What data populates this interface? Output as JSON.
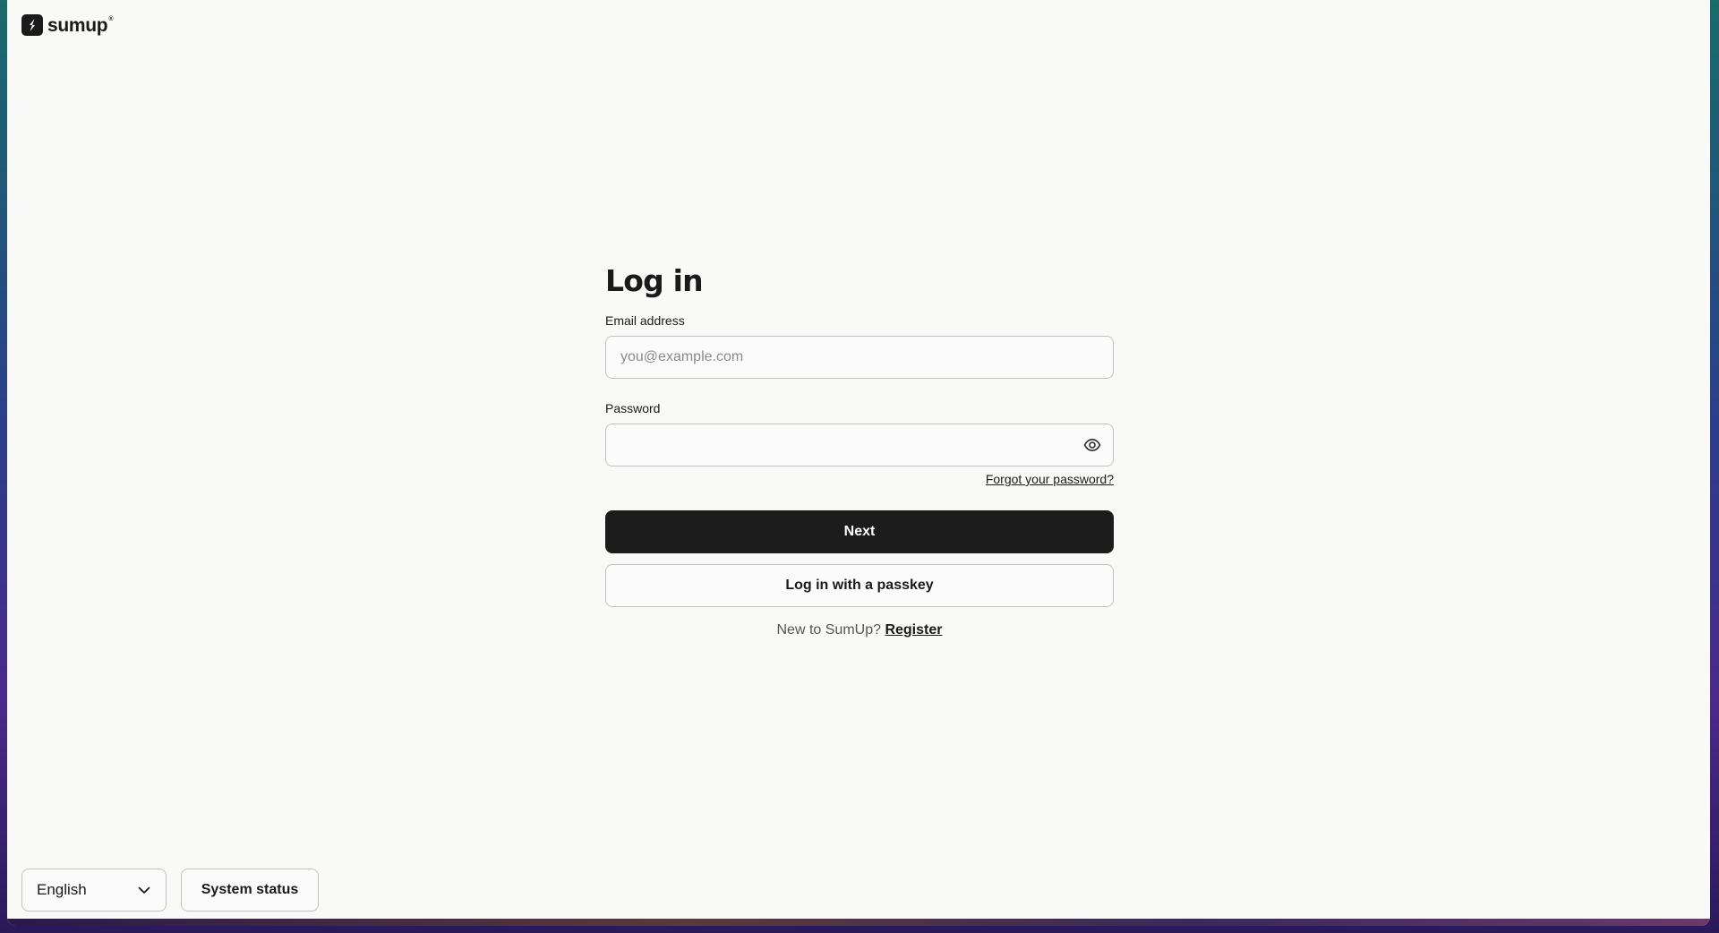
{
  "brand": {
    "name": "sumup",
    "registered_mark": "®"
  },
  "login": {
    "title": "Log in",
    "email": {
      "label": "Email address",
      "placeholder": "you@example.com",
      "value": ""
    },
    "password": {
      "label": "Password",
      "value": "",
      "toggle_icon": "eye-icon"
    },
    "forgot_password_label": "Forgot your password?",
    "next_label": "Next",
    "passkey_label": "Log in with a passkey",
    "register_prompt": "New to SumUp?",
    "register_label": "Register"
  },
  "footer": {
    "language_selected": "English",
    "language_icon": "chevron-down-icon",
    "system_status_label": "System status"
  },
  "colors": {
    "primary_button": "#1c1c1c",
    "page_background": "#f9f9f8",
    "border": "#c2c2c2"
  }
}
